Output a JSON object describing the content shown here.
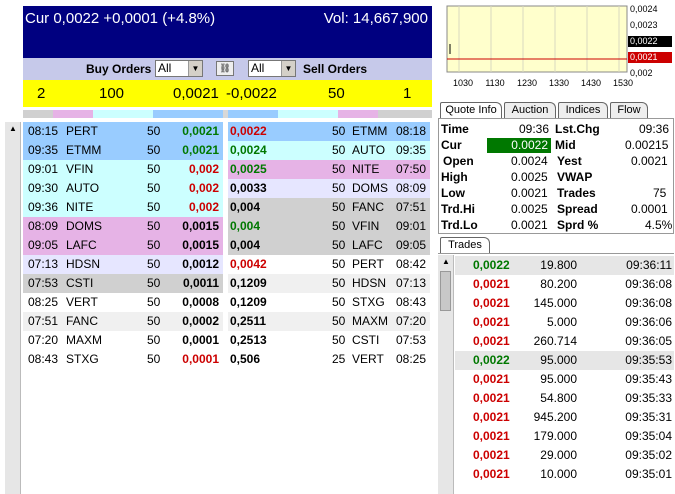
{
  "header": {
    "cur_text": "Cur 0,0022 +0,0001 (+4.8%)",
    "vol_text": "Vol: 14,667,900"
  },
  "controls": {
    "buy_label": "Buy Orders",
    "buy_filter": "All",
    "sell_filter": "All",
    "sell_label": "Sell Orders"
  },
  "totals": {
    "bid_count": "2",
    "bid_size": "100",
    "bid_price": "0,0021",
    "ask_price": "-0,0022",
    "ask_size": "50",
    "ask_count": "1"
  },
  "colors": {
    "header_bg": "#000080",
    "totals_bg": "#ffff00",
    "level1": "#99ccff",
    "level2": "#ccffff",
    "level3": "#e6b3e6",
    "level4": "#e6e6ff",
    "level5": "#d0d0d0",
    "price_up": "#007800",
    "price_down": "#cc0000"
  },
  "buy_orders": [
    {
      "time": "08:15",
      "mm": "PERT",
      "size": "50",
      "price": "0,0021",
      "pcolor": "green",
      "bg": "#99ccff"
    },
    {
      "time": "09:35",
      "mm": "ETMM",
      "size": "50",
      "price": "0,0021",
      "pcolor": "green",
      "bg": "#99ccff"
    },
    {
      "time": "09:01",
      "mm": "VFIN",
      "size": "50",
      "price": "0,002",
      "pcolor": "red",
      "bg": "#ccffff"
    },
    {
      "time": "09:30",
      "mm": "AUTO",
      "size": "50",
      "price": "0,002",
      "pcolor": "red",
      "bg": "#ccffff"
    },
    {
      "time": "09:36",
      "mm": "NITE",
      "size": "50",
      "price": "0,002",
      "pcolor": "red",
      "bg": "#ccffff"
    },
    {
      "time": "08:09",
      "mm": "DOMS",
      "size": "50",
      "price": "0,0015",
      "pcolor": "black",
      "bg": "#e6b3e6"
    },
    {
      "time": "09:05",
      "mm": "LAFC",
      "size": "50",
      "price": "0,0015",
      "pcolor": "black",
      "bg": "#e6b3e6"
    },
    {
      "time": "07:13",
      "mm": "HDSN",
      "size": "50",
      "price": "0,0012",
      "pcolor": "black",
      "bg": "#e6e6ff"
    },
    {
      "time": "07:53",
      "mm": "CSTI",
      "size": "50",
      "price": "0,0011",
      "pcolor": "black",
      "bg": "#d0d0d0"
    },
    {
      "time": "08:25",
      "mm": "VERT",
      "size": "50",
      "price": "0,0008",
      "pcolor": "black",
      "bg": "#ffffff"
    },
    {
      "time": "07:51",
      "mm": "FANC",
      "size": "50",
      "price": "0,0002",
      "pcolor": "black",
      "bg": "#f0f0f0"
    },
    {
      "time": "07:20",
      "mm": "MAXM",
      "size": "50",
      "price": "0,0001",
      "pcolor": "black",
      "bg": "#ffffff"
    },
    {
      "time": "08:43",
      "mm": "STXG",
      "size": "50",
      "price": "0,0001",
      "pcolor": "red",
      "bg": "#ffffff"
    }
  ],
  "sell_orders": [
    {
      "price": "0,0022",
      "size": "50",
      "mm": "ETMM",
      "time": "08:18",
      "pcolor": "red",
      "bg": "#99ccff"
    },
    {
      "price": "0,0024",
      "size": "50",
      "mm": "AUTO",
      "time": "09:35",
      "pcolor": "green",
      "bg": "#ccffff"
    },
    {
      "price": "0,0025",
      "size": "50",
      "mm": "NITE",
      "time": "07:50",
      "pcolor": "green",
      "bg": "#e6b3e6"
    },
    {
      "price": "0,0033",
      "size": "50",
      "mm": "DOMS",
      "time": "08:09",
      "pcolor": "black",
      "bg": "#e6e6ff"
    },
    {
      "price": "0,004",
      "size": "50",
      "mm": "FANC",
      "time": "07:51",
      "pcolor": "black",
      "bg": "#d0d0d0"
    },
    {
      "price": "0,004",
      "size": "50",
      "mm": "VFIN",
      "time": "09:01",
      "pcolor": "green",
      "bg": "#d0d0d0"
    },
    {
      "price": "0,004",
      "size": "50",
      "mm": "LAFC",
      "time": "09:05",
      "pcolor": "black",
      "bg": "#d0d0d0"
    },
    {
      "price": "0,0042",
      "size": "50",
      "mm": "PERT",
      "time": "08:42",
      "pcolor": "red",
      "bg": "#ffffff"
    },
    {
      "price": "0,1209",
      "size": "50",
      "mm": "HDSN",
      "time": "07:13",
      "pcolor": "black",
      "bg": "#f0f0f0"
    },
    {
      "price": "0,1209",
      "size": "50",
      "mm": "STXG",
      "time": "08:43",
      "pcolor": "black",
      "bg": "#ffffff"
    },
    {
      "price": "0,2511",
      "size": "50",
      "mm": "MAXM",
      "time": "07:20",
      "pcolor": "black",
      "bg": "#f0f0f0"
    },
    {
      "price": "0,2513",
      "size": "50",
      "mm": "CSTI",
      "time": "07:53",
      "pcolor": "black",
      "bg": "#ffffff"
    },
    {
      "price": "0,506",
      "size": "25",
      "mm": "VERT",
      "time": "08:25",
      "pcolor": "black",
      "bg": "#ffffff"
    }
  ],
  "mini_chart": {
    "x_ticks": [
      "1030",
      "1130",
      "1230",
      "1330",
      "1430",
      "1530"
    ],
    "y_ticks": [
      "0,0024",
      "0,0023",
      "0,0022",
      "0,0021",
      "0,002"
    ],
    "current_label": "0,0022",
    "prev_label": "0,0021",
    "bg": "#ffffcc"
  },
  "tabs": [
    "Quote Info",
    "Auction",
    "Indices",
    "Flow"
  ],
  "quote": {
    "time_label": "Time",
    "time_value": "09:36",
    "lstchg_label": "Lst.Chg",
    "lstchg_value": "09:36",
    "cur_label": "Cur",
    "cur_value": "0.0022",
    "mid_label": "Mid",
    "mid_value": "0.00215",
    "open_label": "Open",
    "open_value": "0.0024",
    "yest_label": "Yest",
    "yest_value": "0.0021",
    "high_label": "High",
    "high_value": "0.0025",
    "vwap_label": "VWAP",
    "vwap_value": "",
    "low_label": "Low",
    "low_value": "0.0021",
    "trades_label": "Trades",
    "trades_value": "75",
    "trdhi_label": "Trd.Hi",
    "trdhi_value": "0.0025",
    "spread_label": "Spread",
    "spread_value": "0.0001",
    "trdlo_label": "Trd.Lo",
    "trdlo_value": "0.0021",
    "sprd_label": "Sprd %",
    "sprd_value": "4.5%"
  },
  "trades_tab": "Trades",
  "trades": [
    {
      "price": "0,0022",
      "vol": "19.800",
      "time": "09:36:11",
      "pcolor": "green",
      "bg": "#e6e6e6"
    },
    {
      "price": "0,0021",
      "vol": "80.200",
      "time": "09:36:08",
      "pcolor": "red",
      "bg": "#ffffff"
    },
    {
      "price": "0,0021",
      "vol": "145.000",
      "time": "09:36:08",
      "pcolor": "red",
      "bg": "#ffffff"
    },
    {
      "price": "0,0021",
      "vol": "5.000",
      "time": "09:36:06",
      "pcolor": "red",
      "bg": "#ffffff"
    },
    {
      "price": "0,0021",
      "vol": "260.714",
      "time": "09:36:05",
      "pcolor": "red",
      "bg": "#ffffff"
    },
    {
      "price": "0,0022",
      "vol": "95.000",
      "time": "09:35:53",
      "pcolor": "green",
      "bg": "#e6e6e6"
    },
    {
      "price": "0,0021",
      "vol": "95.000",
      "time": "09:35:43",
      "pcolor": "red",
      "bg": "#ffffff"
    },
    {
      "price": "0,0021",
      "vol": "54.800",
      "time": "09:35:33",
      "pcolor": "red",
      "bg": "#ffffff"
    },
    {
      "price": "0,0021",
      "vol": "945.200",
      "time": "09:35:31",
      "pcolor": "red",
      "bg": "#ffffff"
    },
    {
      "price": "0,0021",
      "vol": "179.000",
      "time": "09:35:04",
      "pcolor": "red",
      "bg": "#ffffff"
    },
    {
      "price": "0,0021",
      "vol": "29.000",
      "time": "09:35:02",
      "pcolor": "red",
      "bg": "#ffffff"
    },
    {
      "price": "0,0021",
      "vol": "10.000",
      "time": "09:35:01",
      "pcolor": "red",
      "bg": "#ffffff"
    }
  ]
}
